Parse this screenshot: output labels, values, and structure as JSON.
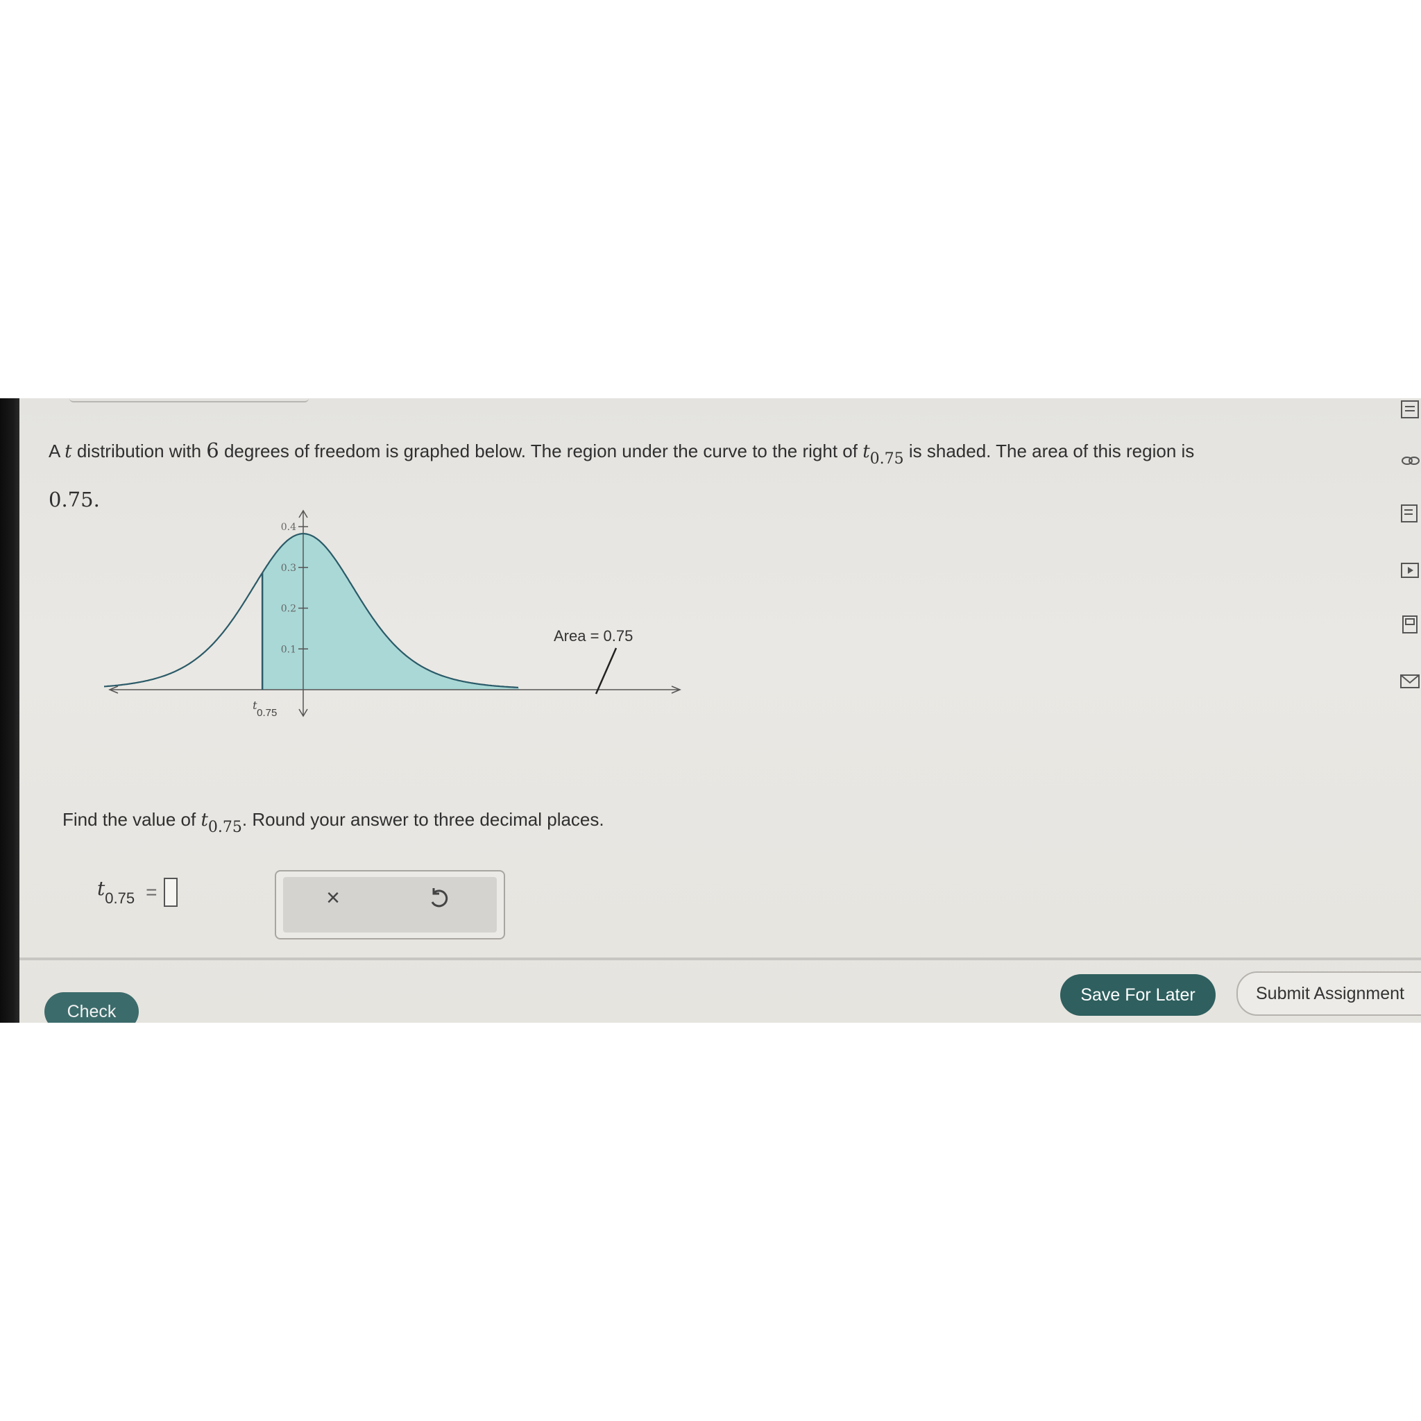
{
  "problem": {
    "prefix": "A",
    "t_symbol": "t",
    "part1": "distribution with",
    "df": "6",
    "part2": "degrees of freedom is graphed below. The region under the curve to the right of",
    "t_sub": "0.75",
    "part3": "is shaded. The area of this region is",
    "area_value": "0.75."
  },
  "chart_data": {
    "type": "area",
    "distribution": "t",
    "degrees_of_freedom": 6,
    "shaded_region": "right of t_0.75",
    "y_ticks": [
      "0.4",
      "0.3",
      "0.2",
      "0.1"
    ],
    "ylim": [
      0,
      0.4
    ],
    "x_label_symbol": "t",
    "x_label_sub": "0.75",
    "annotation": "Area = 0.75",
    "colors": {
      "fill": "#a9d8d6",
      "curve": "#2a5a68",
      "axis": "#555555"
    }
  },
  "find": {
    "text1": "Find the value of",
    "t_symbol": "t",
    "t_sub": "0.75",
    "text2": ". Round your answer to three decimal places."
  },
  "answer": {
    "t_symbol": "t",
    "t_sub": "0.75",
    "equals": "=",
    "value": ""
  },
  "tools": {
    "clear_symbol": "×",
    "undo_icon": "undo-icon"
  },
  "buttons": {
    "check": "Check",
    "save": "Save For Later",
    "submit": "Submit Assignment"
  },
  "sidebar": {
    "icons": [
      "calculator-icon",
      "link-icon",
      "notes-icon",
      "video-icon",
      "book-icon",
      "mail-icon"
    ]
  }
}
